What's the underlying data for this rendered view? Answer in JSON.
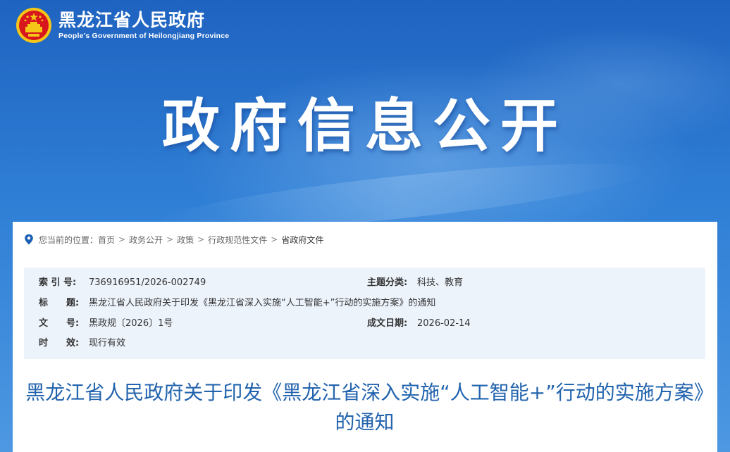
{
  "site": {
    "name": "黑龙江省人民政府",
    "name_en": "People's Government of Heilongjiang Province"
  },
  "hero": {
    "title": "政府信息公开"
  },
  "breadcrumb": {
    "prefix": "您当前的位置：",
    "items": [
      "首页",
      "政务公开",
      "政策",
      "行政规范性文件",
      "省政府文件"
    ],
    "separator": ">"
  },
  "meta": {
    "index_label": "索 引 号:",
    "index_value": "736916951/2026-002749",
    "topic_label": "主题分类:",
    "topic_value": "科技、教育",
    "title_label": "标　　题:",
    "title_value": "黑龙江省人民政府关于印发《黑龙江省深入实施“人工智能+”行动的实施方案》的通知",
    "docno_label": "文　　号:",
    "docno_value": "黑政规〔2026〕1号",
    "date_label": "成文日期:",
    "date_value": "2026-02-14",
    "validity_label": "时　　效:",
    "validity_value": "现行有效"
  },
  "document": {
    "title": "黑龙江省人民政府关于印发《黑龙江省深入实施“人工智能+”行动的实施方案》的通知"
  },
  "colors": {
    "hero_blue": "#2a73c9",
    "title_blue": "#2364ae",
    "meta_bg": "#edf3fb",
    "emblem_red": "#d7161d",
    "emblem_gold": "#f5c518"
  }
}
